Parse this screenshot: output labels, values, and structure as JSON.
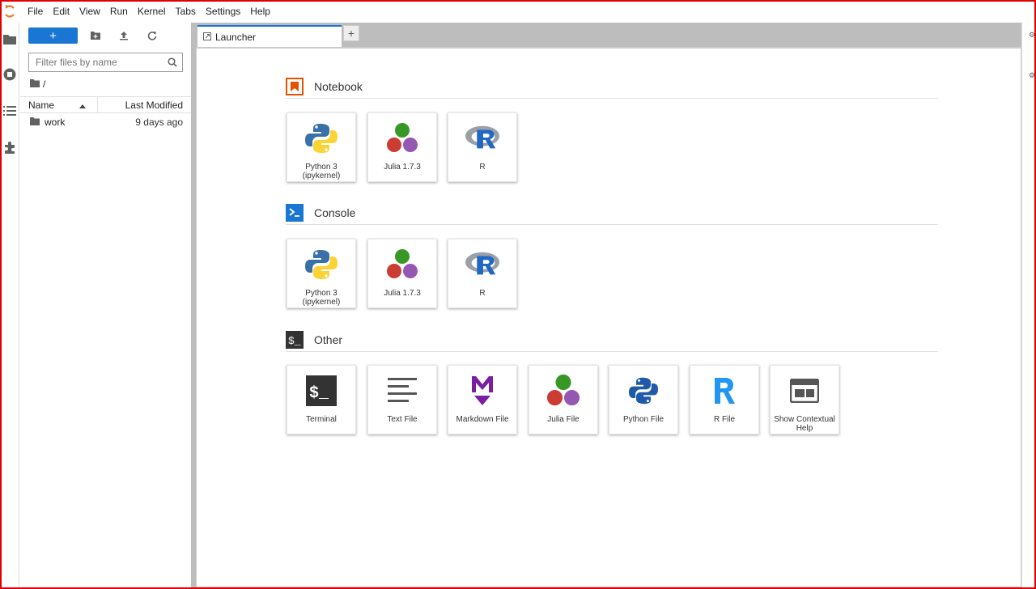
{
  "menu": [
    "File",
    "Edit",
    "View",
    "Run",
    "Kernel",
    "Tabs",
    "Settings",
    "Help"
  ],
  "filebrowser": {
    "new_label": "+",
    "filter_placeholder": "Filter files by name",
    "breadcrumb": "/",
    "columns": {
      "name": "Name",
      "modified": "Last Modified"
    },
    "rows": [
      {
        "name": "work",
        "modified": "9 days ago"
      }
    ]
  },
  "tabs": [
    {
      "label": "Launcher"
    }
  ],
  "add_tab": "+",
  "launcher": {
    "sections": [
      {
        "title": "Notebook",
        "icon": "notebook-icon",
        "cards": [
          {
            "label": "Python 3\n(ipykernel)",
            "icon": "python-logo"
          },
          {
            "label": "Julia 1.7.3",
            "icon": "julia-logo"
          },
          {
            "label": "R",
            "icon": "r-logo"
          }
        ]
      },
      {
        "title": "Console",
        "icon": "console-icon",
        "cards": [
          {
            "label": "Python 3\n(ipykernel)",
            "icon": "python-logo"
          },
          {
            "label": "Julia 1.7.3",
            "icon": "julia-logo"
          },
          {
            "label": "R",
            "icon": "r-logo"
          }
        ]
      },
      {
        "title": "Other",
        "icon": "terminal-icon",
        "cards": [
          {
            "label": "Terminal",
            "icon": "terminal-icon"
          },
          {
            "label": "Text File",
            "icon": "text-file-icon"
          },
          {
            "label": "Markdown File",
            "icon": "markdown-icon"
          },
          {
            "label": "Julia File",
            "icon": "julia-logo"
          },
          {
            "label": "Python File",
            "icon": "python-file-icon"
          },
          {
            "label": "R File",
            "icon": "r-file-icon"
          },
          {
            "label": "Show Contextual Help",
            "icon": "contextual-help-icon"
          }
        ]
      }
    ]
  },
  "colors": {
    "accent": "#1976d2",
    "notebook": "#e65100",
    "console": "#1976d2",
    "other": "#333333",
    "frame": "#e00000"
  }
}
